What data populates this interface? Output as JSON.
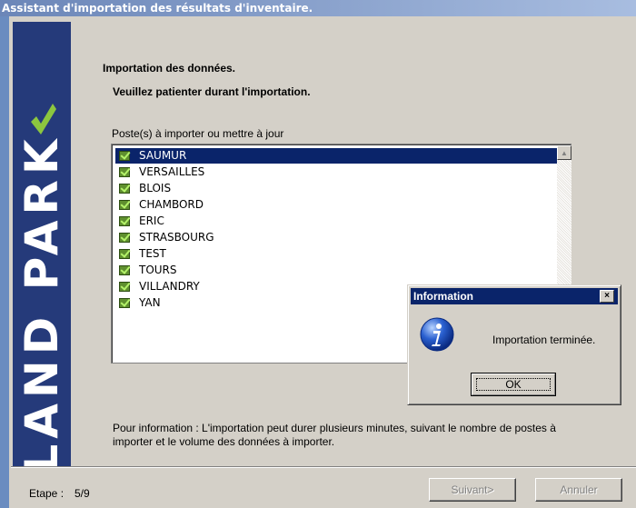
{
  "window": {
    "title": "Assistant d'importation des résultats d'inventaire."
  },
  "banner": {
    "brand": "LAND PARK"
  },
  "page": {
    "heading": "Importation des données.",
    "subheading": "Veuillez patienter durant l'importation.",
    "list_label": "Poste(s) à importer ou mettre à jour",
    "info": "Pour information : L'importation peut durer plusieurs minutes, suivant le nombre de postes à importer et le volume des données à importer."
  },
  "list": {
    "items": [
      "SAUMUR",
      "VERSAILLES",
      "BLOIS",
      "CHAMBORD",
      "ERIC",
      "STRASBOURG",
      "TEST",
      "TOURS",
      "VILLANDRY",
      "YAN"
    ],
    "selected_index": 0
  },
  "footer": {
    "step_label": "Etape :",
    "step_value": "5/9",
    "next_label": "Suivant>",
    "cancel_label": "Annuler"
  },
  "dialog": {
    "title": "Information",
    "close_glyph": "×",
    "message": "Importation terminée.",
    "ok_label": "OK"
  },
  "colors": {
    "selection": "#0a246a",
    "banner": "#253a7a",
    "brand_check": "#8cc63f"
  }
}
